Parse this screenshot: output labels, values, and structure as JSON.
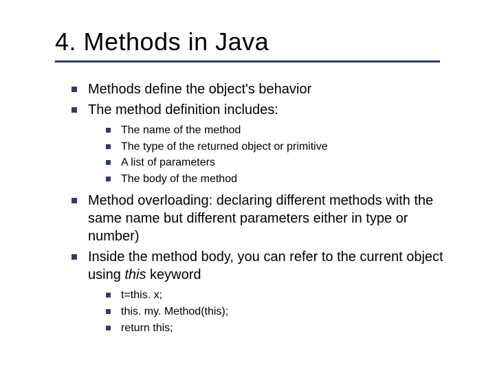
{
  "title": "4. Methods in Java",
  "bullets": {
    "b1": "Methods define the object's behavior",
    "b2": "The method definition includes:",
    "b2_sub": {
      "s1": "The name of the method",
      "s2": "The type of the returned object or primitive",
      "s3": "A list of parameters",
      "s4": "The body of the method"
    },
    "b3": "Method overloading: declaring different methods with the same name but different parameters either in type or number)",
    "b4_pre": "Inside the method body, you can refer to the current object using ",
    "b4_italic": "this",
    "b4_post": " keyword",
    "b4_sub": {
      "s1": "t=this. x;",
      "s2": "this. my. Method(this);",
      "s3": "return this;"
    }
  }
}
